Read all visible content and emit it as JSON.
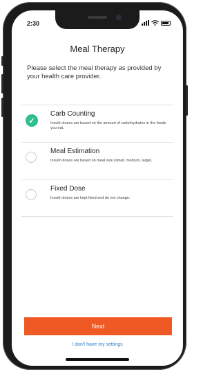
{
  "status_bar": {
    "time": "2:30"
  },
  "header": {
    "title": "Meal Therapy"
  },
  "instruction": "Please select the meal therapy as provided by your health care provider.",
  "options": [
    {
      "title": "Carb Counting",
      "description": "Insulin doses are based on the amount of carbohydrates in the foods you eat.",
      "selected": true
    },
    {
      "title": "Meal Estimation",
      "description": "Insulin doses are based on meal size (small, medium, large).",
      "selected": false
    },
    {
      "title": "Fixed Dose",
      "description": "Insulin doses are kept fixed and do not change.",
      "selected": false
    }
  ],
  "buttons": {
    "next": "Next"
  },
  "links": {
    "no_settings": "I don't have my settings"
  },
  "icons": {
    "check": "✓"
  },
  "colors": {
    "accent": "#ef5a24",
    "selected": "#2fbf8f",
    "link": "#2a7ac0"
  }
}
